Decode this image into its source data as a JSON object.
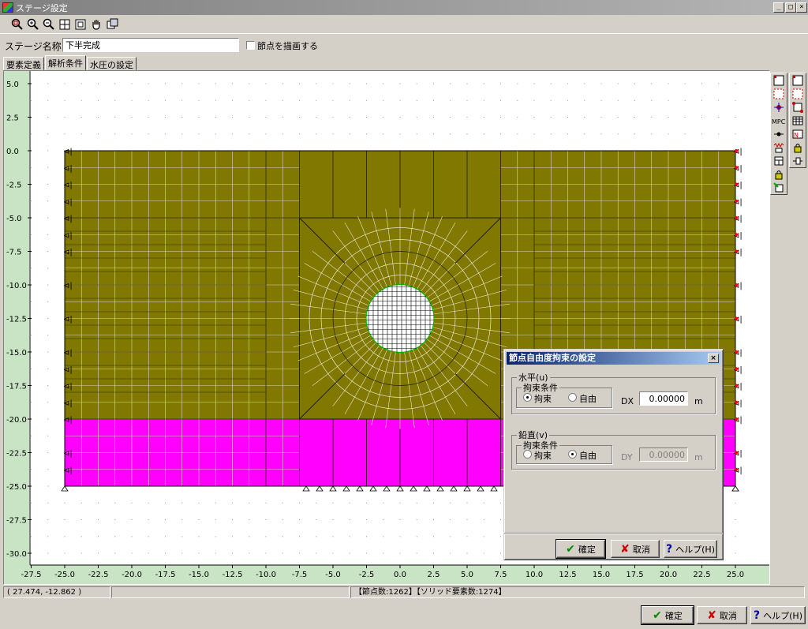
{
  "window": {
    "title": "ステージ設定",
    "min": "_",
    "max": "□",
    "close": "×"
  },
  "toolbar": {
    "icons": [
      "zoom-window-icon",
      "zoom-in-icon",
      "zoom-out-icon",
      "fit-all-icon",
      "zoom-previous-icon",
      "pan-hand-icon",
      "copy-view-icon"
    ]
  },
  "stage": {
    "label": "ステージ名称",
    "value": "下半完成",
    "draw_nodes_label": "節点を描画する",
    "draw_nodes_checked": false
  },
  "tabs": [
    {
      "label": "要素定義",
      "active": false
    },
    {
      "label": "解析条件",
      "active": true
    },
    {
      "label": "水圧の設定",
      "active": false
    }
  ],
  "plot": {
    "y_ticks": [
      "5.0",
      "2.5",
      "0.0",
      "-2.5",
      "-5.0",
      "-7.5",
      "-10.0",
      "-12.5",
      "-15.0",
      "-17.5",
      "-20.0",
      "-22.5",
      "-25.0",
      "-27.5",
      "-30.0"
    ],
    "x_ticks": [
      "-27.5",
      "-25.0",
      "-22.5",
      "-20.0",
      "-17.5",
      "-15.0",
      "-12.5",
      "-10.0",
      "-7.5",
      "-5.0",
      "-2.5",
      "0.0",
      "2.5",
      "5.0",
      "7.5",
      "10.0",
      "12.5",
      "15.0",
      "17.5",
      "20.0",
      "22.5",
      "25.0"
    ],
    "colors": {
      "upper_layer": "#807800",
      "lower_layer": "#ff00ff",
      "background": "#ffffff",
      "margin": "#c9e3c5"
    }
  },
  "status": {
    "coords": "( 27.474, -12.862 )",
    "counts": "【節点数:1262】【ソリッド要素数:1274】"
  },
  "dialog": {
    "title": "節点自由度拘束の設定",
    "close": "×",
    "horizontal": {
      "group": "水平(u)",
      "sub": "拘束条件",
      "opt_fixed": "拘束",
      "opt_free": "自由",
      "selected": "拘束",
      "field_label": "DX",
      "value": "0.00000",
      "unit": "m"
    },
    "vertical": {
      "group": "鉛直(v)",
      "sub": "拘束条件",
      "opt_fixed": "拘束",
      "opt_free": "自由",
      "selected": "自由",
      "field_label": "DY",
      "value": "0.00000",
      "unit": "m"
    },
    "ok": "確定",
    "cancel": "取消",
    "help": "ヘルプ(H)"
  },
  "footer": {
    "ok": "確定",
    "cancel": "取消",
    "help": "ヘルプ(H)"
  }
}
